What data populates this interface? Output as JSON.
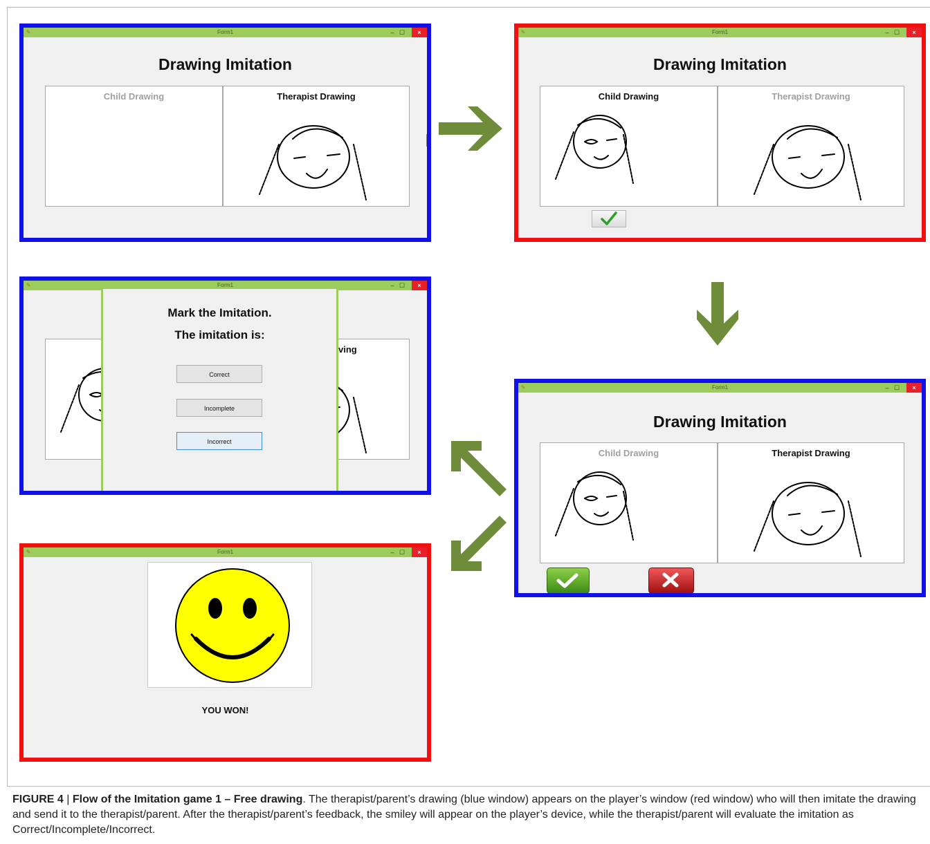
{
  "window_title": "Form1",
  "app_title": "Drawing Imitation",
  "child_drawing_label": "Child Drawing",
  "therapist_drawing_label": "Therapist Drawing",
  "therapist_drawing_label_cropped": "ving",
  "dialog": {
    "line1": "Mark the Imitation.",
    "line2": "The imitation is:",
    "buttons": [
      "Correct",
      "Incomplete",
      "Incorrect"
    ]
  },
  "result_text": "YOU WON!",
  "colors": {
    "therapist_window_border": "#1010e8",
    "player_window_border": "#f01010",
    "titlebar": "#9ccc5c",
    "flow_arrow": "#6f8c3a",
    "smiley_face": "#ffff00"
  },
  "icons": {
    "accept": "check-icon",
    "reject": "x-icon",
    "result": "smiley-icon",
    "flow": "arrow-icon"
  },
  "caption": {
    "figure_id": "FIGURE 4",
    "separator": " | ",
    "title": "Flow of the Imitation game 1 – Free drawing",
    "body": ". The therapist/parent’s drawing (blue window) appears on the player’s window (red window) who will then imitate the drawing and send it to the therapist/parent. After the therapist/parent’s feedback, the smiley will appear on the player’s device, while the therapist/parent will evaluate the imitation as Correct/Incomplete/Incorrect."
  }
}
